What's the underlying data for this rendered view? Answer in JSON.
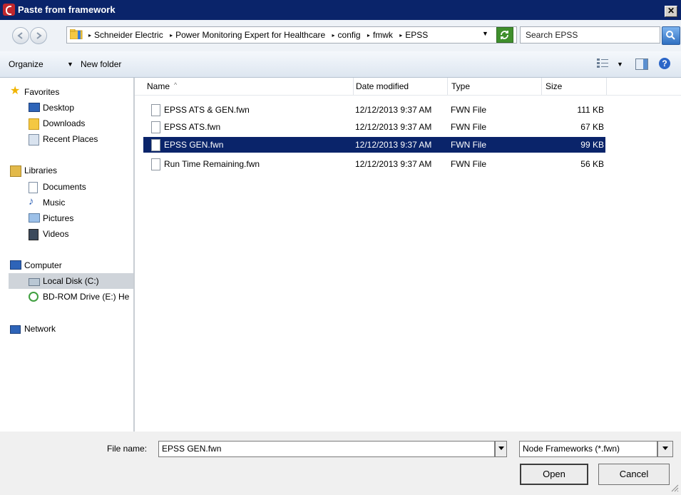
{
  "window": {
    "title": "Paste from framework",
    "close_label": "✕",
    "app_icon": "app-logo-icon"
  },
  "address": {
    "crumbs": [
      "Schneider Electric",
      "Power Monitoring Expert for Healthcare",
      "config",
      "fmwk",
      "EPSS"
    ],
    "search_placeholder": "Search EPSS"
  },
  "toolbar": {
    "organize": "Organize",
    "new_folder": "New folder"
  },
  "nav": {
    "favorites": "Favorites",
    "desktop": "Desktop",
    "downloads": "Downloads",
    "recent": "Recent Places",
    "libraries": "Libraries",
    "documents": "Documents",
    "music": "Music",
    "pictures": "Pictures",
    "videos": "Videos",
    "computer": "Computer",
    "local_disk": "Local Disk (C:)",
    "bdrom": "BD-ROM Drive (E:) He",
    "network": "Network"
  },
  "columns": {
    "name": "Name",
    "date": "Date modified",
    "type": "Type",
    "size": "Size"
  },
  "files": [
    {
      "name": "EPSS ATS & GEN.fwn",
      "date": "12/12/2013 9:37 AM",
      "type": "FWN File",
      "size": "111 KB"
    },
    {
      "name": "EPSS ATS.fwn",
      "date": "12/12/2013 9:37 AM",
      "type": "FWN File",
      "size": "67 KB"
    },
    {
      "name": "EPSS GEN.fwn",
      "date": "12/12/2013 9:37 AM",
      "type": "FWN File",
      "size": "99 KB"
    },
    {
      "name": "Run Time Remaining.fwn",
      "date": "12/12/2013 9:37 AM",
      "type": "FWN File",
      "size": "56 KB"
    }
  ],
  "selected_index": 2,
  "bottom": {
    "filename_label": "File name:",
    "filename_value": "EPSS GEN.fwn",
    "filter": "Node Frameworks (*.fwn)",
    "open": "Open",
    "cancel": "Cancel"
  },
  "colors": {
    "titlebar": "#0a246a",
    "selection": "#0a246a",
    "background": "#f0f0f0"
  }
}
